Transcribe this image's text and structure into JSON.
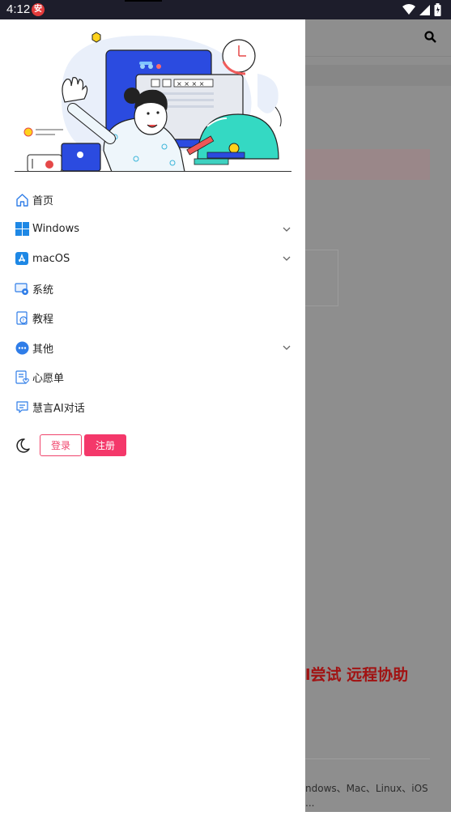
{
  "status_bar": {
    "time": "4:12",
    "app_badge": "安"
  },
  "background_page": {
    "headline_fragment": "l尝试 远程协助",
    "footnote_line1": "ndows、Mac、Linux、iOS",
    "footnote_line2": "..."
  },
  "drawer": {
    "menu": [
      {
        "label": "首页",
        "icon": "home-icon",
        "has_submenu": false
      },
      {
        "label": "Windows",
        "icon": "windows-icon",
        "has_submenu": true
      },
      {
        "label": "macOS",
        "icon": "app-store-icon",
        "has_submenu": true
      },
      {
        "label": "系统",
        "icon": "system-icon",
        "has_submenu": false
      },
      {
        "label": "教程",
        "icon": "tutorial-icon",
        "has_submenu": false
      },
      {
        "label": "其他",
        "icon": "more-icon",
        "has_submenu": true
      },
      {
        "label": "心愿单",
        "icon": "wishlist-icon",
        "has_submenu": false
      },
      {
        "label": "慧言AI对话",
        "icon": "chat-icon",
        "has_submenu": false
      }
    ],
    "auth": {
      "login_label": "登录",
      "register_label": "注册"
    }
  },
  "colors": {
    "accent": "#f4386a",
    "drawer_bg": "#ffffff",
    "overlay": "#8e8e8e",
    "headline": "#a11313"
  }
}
